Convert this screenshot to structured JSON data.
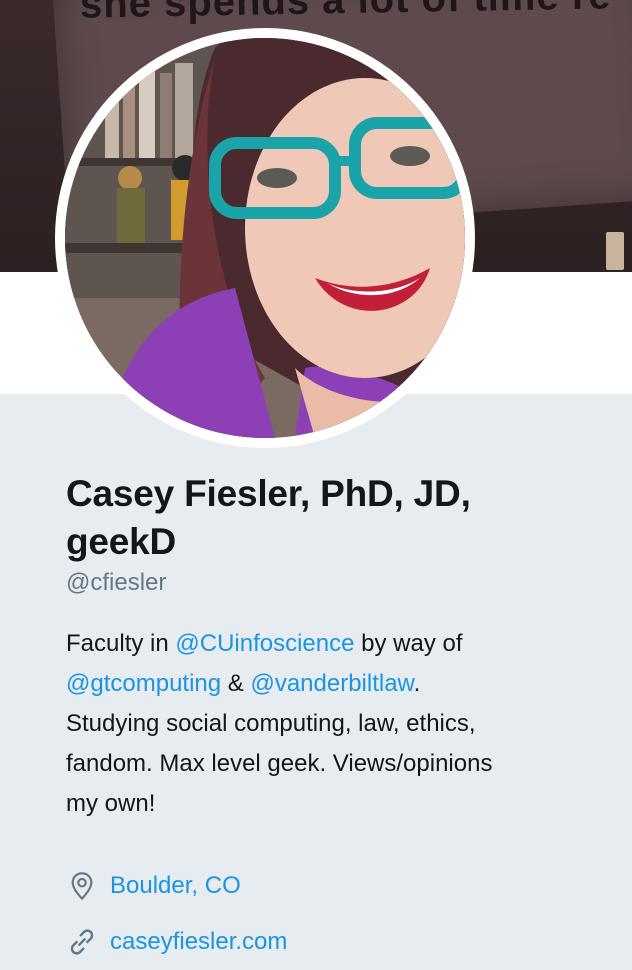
{
  "banner": {
    "poster_text": "she spends a lot of time re"
  },
  "profile": {
    "display_name_line1": "Casey Fiesler, PhD, JD,",
    "display_name_line2": "geekD",
    "handle": "@cfiesler",
    "bio": {
      "prefix": "Faculty in ",
      "mention1": "@CUinfoscience",
      "mid1": " by way of",
      "mention2": "@gtcomputing",
      "amp": " & ",
      "mention3": "@vanderbiltlaw",
      "dot": ".",
      "rest_line1": "Studying social computing, law, ethics,",
      "rest_line2": "fandom. Max level geek. Views/opinions",
      "rest_line3": "my own!"
    },
    "location": "Boulder, CO",
    "website": "caseyfiesler.com"
  },
  "colors": {
    "link": "#1b95e0",
    "text": "#14171a",
    "muted": "#657786",
    "background": "#e6ecf0"
  },
  "icons": {
    "location": "map-pin-icon",
    "website": "link-icon"
  }
}
